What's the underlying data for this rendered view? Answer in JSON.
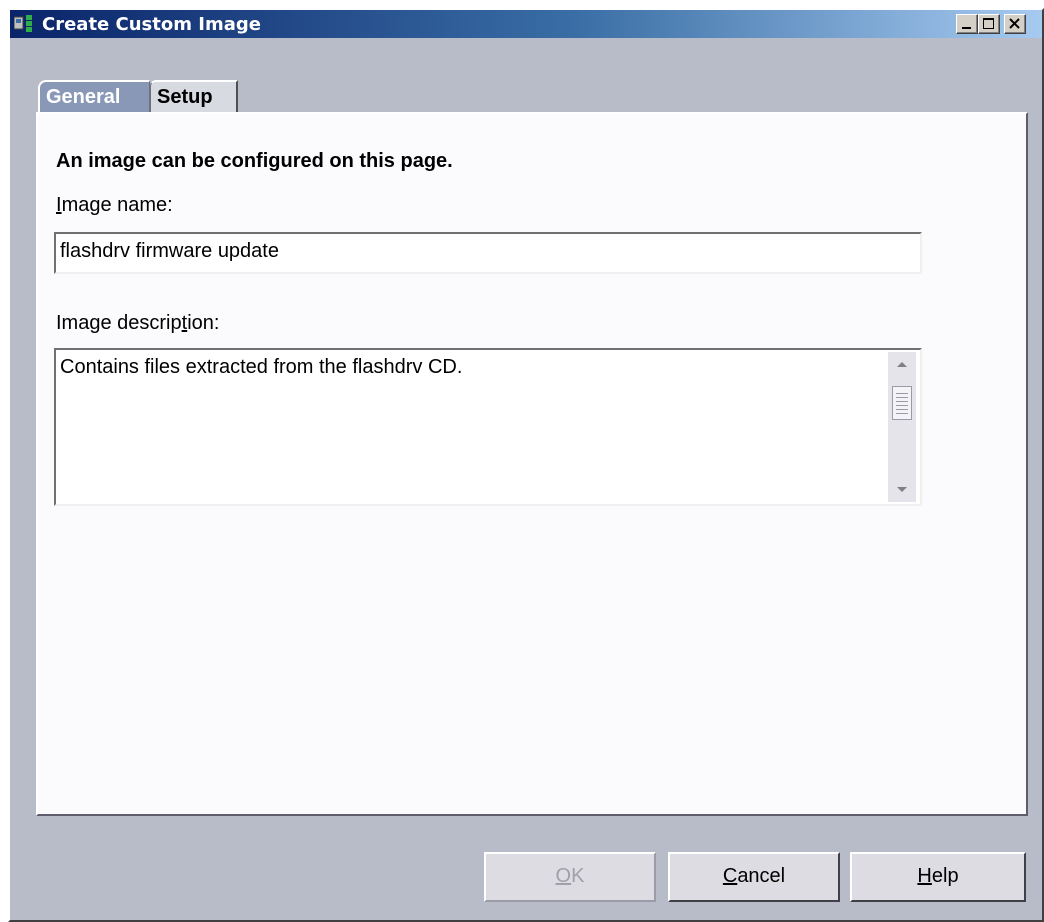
{
  "window": {
    "title": "Create Custom Image",
    "controls": {
      "minimize_icon": "minimize-icon",
      "maximize_icon": "maximize-icon",
      "close_icon": "close-icon"
    }
  },
  "tabs": [
    {
      "label": "General",
      "selected": true
    },
    {
      "label": "Setup",
      "selected": false
    }
  ],
  "general": {
    "heading": "An image can be configured on this page.",
    "name_label_mnemonic": "I",
    "name_label_rest": "mage name:",
    "name_value": "flashdrv firmware update",
    "desc_label_pre": "Image descrip",
    "desc_label_mnemonic": "t",
    "desc_label_post": "ion:",
    "desc_value": "Contains files extracted from the flashdrv CD."
  },
  "buttons": {
    "ok_mnemonic": "O",
    "ok_rest": "K",
    "ok_enabled": false,
    "cancel_mnemonic": "C",
    "cancel_rest": "ancel",
    "help_mnemonic": "H",
    "help_rest": "elp"
  },
  "colors": {
    "title_gradient_start": "#0a246a",
    "title_gradient_end": "#a6caf0",
    "window_bg": "#b8bcc8",
    "selected_tab": "#8a98b8"
  }
}
